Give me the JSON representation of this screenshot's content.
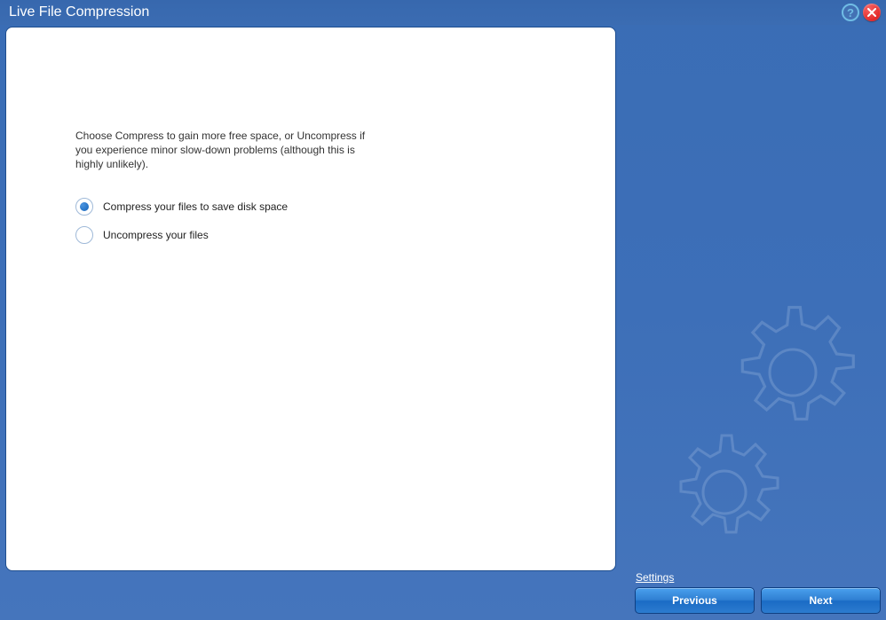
{
  "titlebar": {
    "title": "Live File Compression"
  },
  "main": {
    "instruction": "Choose Compress to gain more free space, or Uncompress if you experience minor slow-down problems (although this is highly unlikely).",
    "options": {
      "compress": "Compress your files to save disk space",
      "uncompress": "Uncompress your files",
      "selected": "compress"
    }
  },
  "footer": {
    "settings": "Settings",
    "previous": "Previous",
    "next": "Next"
  }
}
